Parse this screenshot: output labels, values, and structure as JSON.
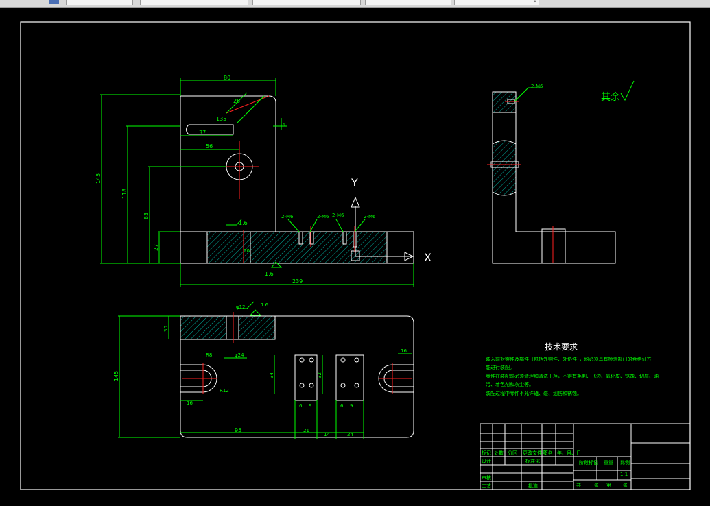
{
  "tabs": [
    {
      "label": ""
    },
    {
      "label": ""
    },
    {
      "label": ""
    },
    {
      "label": ""
    },
    {
      "label": ""
    }
  ],
  "drawing": {
    "axis_y": "Y",
    "axis_x": "X",
    "surface_note": "其余",
    "tech_title": "技术要求",
    "tech_lines": [
      "装入前对零件及部件（包括外购件、外协件），均必须具有检验部门的合格证方",
      "能进行装配。",
      "零件在装配前必须清理和清洗干净，不得有毛刺、飞边、氧化皮、锈蚀、切屑、油",
      "污、着色剂和灰尘等。",
      "装配过程中零件不允许磕、碰、划伤和锈蚀。"
    ],
    "dims": {
      "top_width": "80",
      "dim_37": "37",
      "dim_56": "56",
      "height_145": "145",
      "height_118": "118",
      "height_83": "83",
      "height_27": "27",
      "base_width": "239",
      "rough_16": "1.6",
      "rough_16b": "1.6",
      "dim_135": "135",
      "dim_25": "25",
      "dim_4": "4",
      "dim_20": "20",
      "hole_2m6a": "2-M6",
      "hole_2m6b": "2-M6",
      "hole_2m6c": "2-M6",
      "hole_2m6d": "2-M6",
      "side_hole": "2-M6",
      "plan_diam": "φ12",
      "plan_16": "1.6",
      "plan_30": "30",
      "plan_145": "145",
      "plan_16b": "16",
      "plan_95": "95",
      "plan_21": "21",
      "plan_14": "14",
      "plan_24": "24",
      "plan_dia24": "φ24",
      "plan_r12": "R12",
      "plan_r8": "R8",
      "plan_34": "34",
      "plan_32": "32",
      "plan_6a": "6",
      "plan_9a": "9",
      "plan_6b": "6",
      "plan_9b": "9",
      "plan_16c": "16"
    },
    "title_block": {
      "row1": [
        "标记",
        "处数",
        "分区",
        "更改文件号",
        "签名",
        "年、月、日"
      ],
      "design": "设计",
      "standard": "标准化",
      "stage": "阶段标记",
      "weight": "重量",
      "scale": "比例",
      "scale_val": "1:1",
      "review": "审核",
      "process": "工艺",
      "approve": "批准",
      "sheets": [
        "共",
        "张",
        "第",
        "张"
      ]
    }
  }
}
